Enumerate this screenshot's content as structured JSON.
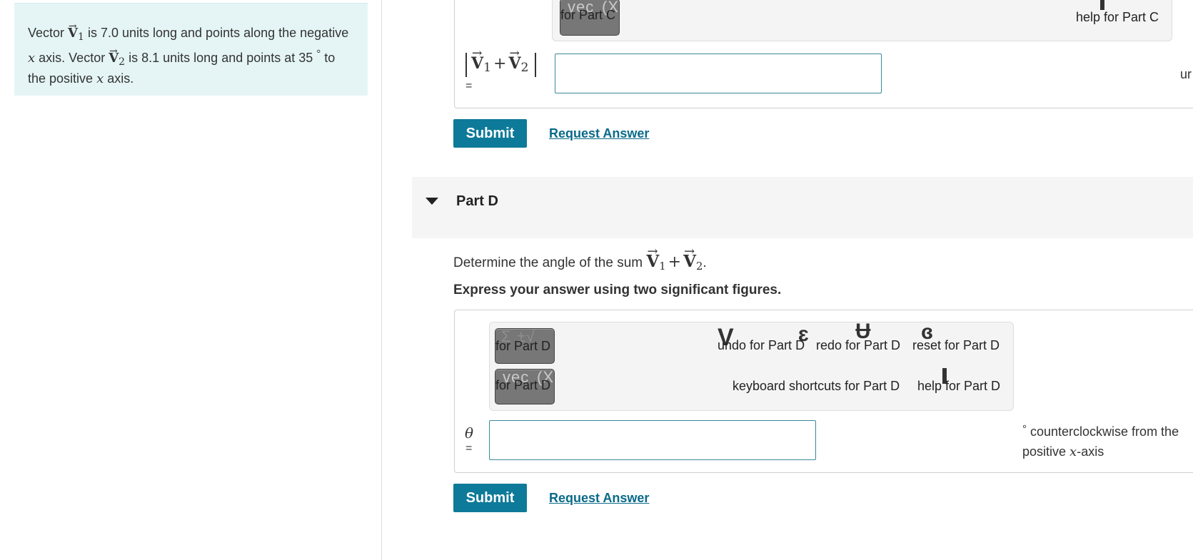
{
  "problem": {
    "t1": "Vector ",
    "v1_letter": "V",
    "v1_sub": "1",
    "t2": " is 7.0 units long and points along the negative ",
    "x1": "x",
    "t3": " axis. Vector ",
    "v2_letter": "V",
    "v2_sub": "2",
    "t4": " is 8.1 units long and points at 35 ",
    "deg": "°",
    "t5": " to the positive ",
    "x2": "x",
    "t6": " axis."
  },
  "partC": {
    "tool_vec_ghost": "vec",
    "tool_vec_ghost2": "(X",
    "tool_vec_caption": "for Part C",
    "help_label": "help for Part C",
    "expr_v1": "V",
    "expr_sub1": "1",
    "expr_plus": "+",
    "expr_v2": "V",
    "expr_sub2": "2",
    "equals": "=",
    "unit_partial": "ur",
    "submit": "Submit",
    "request_answer": "Request Answer"
  },
  "partD": {
    "title": "Part D",
    "question_prefix": "Determine the angle of the sum ",
    "q_v1": "V",
    "q_sub1": "1",
    "q_plus": "+",
    "q_v2": "V",
    "q_sub2": "2",
    "question_suffix": ".",
    "instruction": "Express your answer using two significant figures.",
    "tool_sum_ghost": "Σ ±√",
    "tool_sum_caption": "for Part D",
    "tool_vec_ghost": "vec",
    "tool_vec_ghost2": "(X",
    "tool_vec_caption": "for Part D",
    "undo_label": "undo for Part D",
    "redo_label": "redo for Part D",
    "reset_label": "reset for Part D",
    "keyboard_label": "keyboard shortcuts for Part D",
    "help_label": "help for Part D",
    "theta": "θ",
    "equals": "=",
    "unit_deg": "°",
    "unit_line1": " counterclockwise from the",
    "unit_line2a": "positive ",
    "unit_x": "x",
    "unit_line2b": "-axis",
    "submit": "Submit",
    "request_answer": "Request Answer"
  },
  "colors": {
    "accent": "#0e7a99",
    "link": "#0a6a89",
    "problem_bg": "#e5f5f6",
    "input_border": "#3a8a9a"
  }
}
